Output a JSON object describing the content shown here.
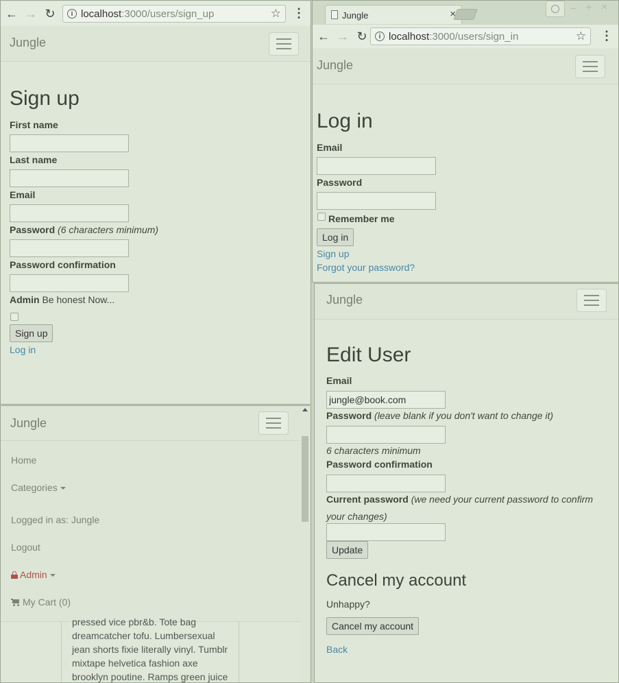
{
  "signup": {
    "url_host": "localhost",
    "url_path": ":3000/users/sign_up",
    "brand": "Jungle",
    "title": "Sign up",
    "first_name_label": "First name",
    "last_name_label": "Last name",
    "email_label": "Email",
    "password_label": "Password",
    "password_hint": "(6 characters minimum)",
    "password_confirmation_label": "Password confirmation",
    "admin_label": "Admin",
    "admin_note": "Be honest Now...",
    "submit_label": "Sign up",
    "login_link": "Log in"
  },
  "login": {
    "tab_title": "Jungle",
    "url_host": "localhost",
    "url_path": ":3000/users/sign_in",
    "brand": "Jungle",
    "title": "Log in",
    "email_label": "Email",
    "password_label": "Password",
    "remember_label": "Remember me",
    "submit_label": "Log in",
    "signup_link": "Sign up",
    "forgot_link": "Forgot your password?"
  },
  "menu": {
    "brand": "Jungle",
    "items": {
      "home": "Home",
      "categories": "Categories",
      "logged_in": "Logged in as: Jungle",
      "logout": "Logout",
      "admin": "Admin",
      "cart": "My Cart (0)"
    },
    "body_text": [
      "pressed vice pbr&b. Tote bag",
      "dreamcatcher tofu. Lumbersexual",
      "jean shorts fixie literally vinyl. Tumblr",
      "mixtape helvetica fashion axe",
      "brooklyn poutine. Ramps green juice"
    ]
  },
  "edit": {
    "brand": "Jungle",
    "title": "Edit User",
    "email_label": "Email",
    "email_value": "jungle@book.com",
    "password_label": "Password",
    "password_hint": "(leave blank if you don't want to change it)",
    "password_min": "6 characters minimum",
    "password_confirmation_label": "Password confirmation",
    "current_password_label": "Current password",
    "current_password_hint_1": "(we need your current password to confirm",
    "current_password_hint_2": "your changes)",
    "update_label": "Update",
    "cancel_heading": "Cancel my account",
    "unhappy": "Unhappy?",
    "cancel_button": "Cancel my account",
    "back_link": "Back"
  },
  "colors": {
    "page_bg": "#dfe8d8",
    "link": "#4a86a8",
    "admin_red": "#b0504c"
  },
  "icons": [
    "back-arrow-icon",
    "forward-arrow-icon",
    "reload-icon",
    "info-icon",
    "star-icon",
    "menu-dots-icon",
    "hamburger-icon",
    "lock-icon",
    "cart-icon",
    "page-icon",
    "close-icon",
    "profile-icon",
    "minimize-icon",
    "maximize-icon"
  ]
}
